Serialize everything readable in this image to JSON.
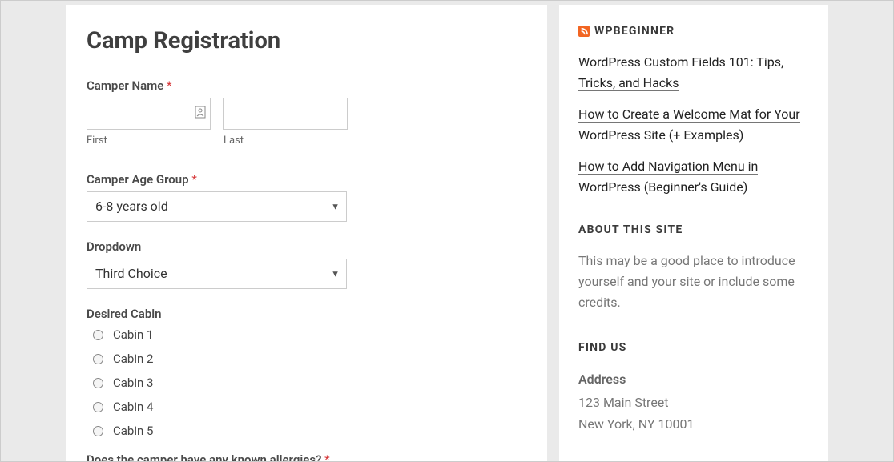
{
  "main": {
    "title": "Camp Registration",
    "camper_name": {
      "label": "Camper Name",
      "required": "*",
      "first_sublabel": "First",
      "last_sublabel": "Last"
    },
    "age_group": {
      "label": "Camper Age Group",
      "required": "*",
      "selected": "6-8 years old"
    },
    "dropdown": {
      "label": "Dropdown",
      "selected": "Third Choice"
    },
    "cabin": {
      "label": "Desired Cabin",
      "options": [
        "Cabin 1",
        "Cabin 2",
        "Cabin 3",
        "Cabin 4",
        "Cabin 5"
      ]
    },
    "allergies": {
      "label": "Does the camper have any known allergies?",
      "required": "*"
    }
  },
  "sidebar": {
    "rss": {
      "title": "WPBEGINNER",
      "items": [
        "WordPress Custom Fields 101: Tips, Tricks, and Hacks",
        "How to Create a Welcome Mat for Your WordPress Site (+ Examples)",
        "How to Add Navigation Menu in WordPress (Beginner's Guide)"
      ]
    },
    "about": {
      "title": "ABOUT THIS SITE",
      "text": "This may be a good place to introduce yourself and your site or include some credits."
    },
    "findus": {
      "title": "FIND US",
      "address_label": "Address",
      "line1": "123 Main Street",
      "line2": "New York, NY 10001"
    }
  }
}
